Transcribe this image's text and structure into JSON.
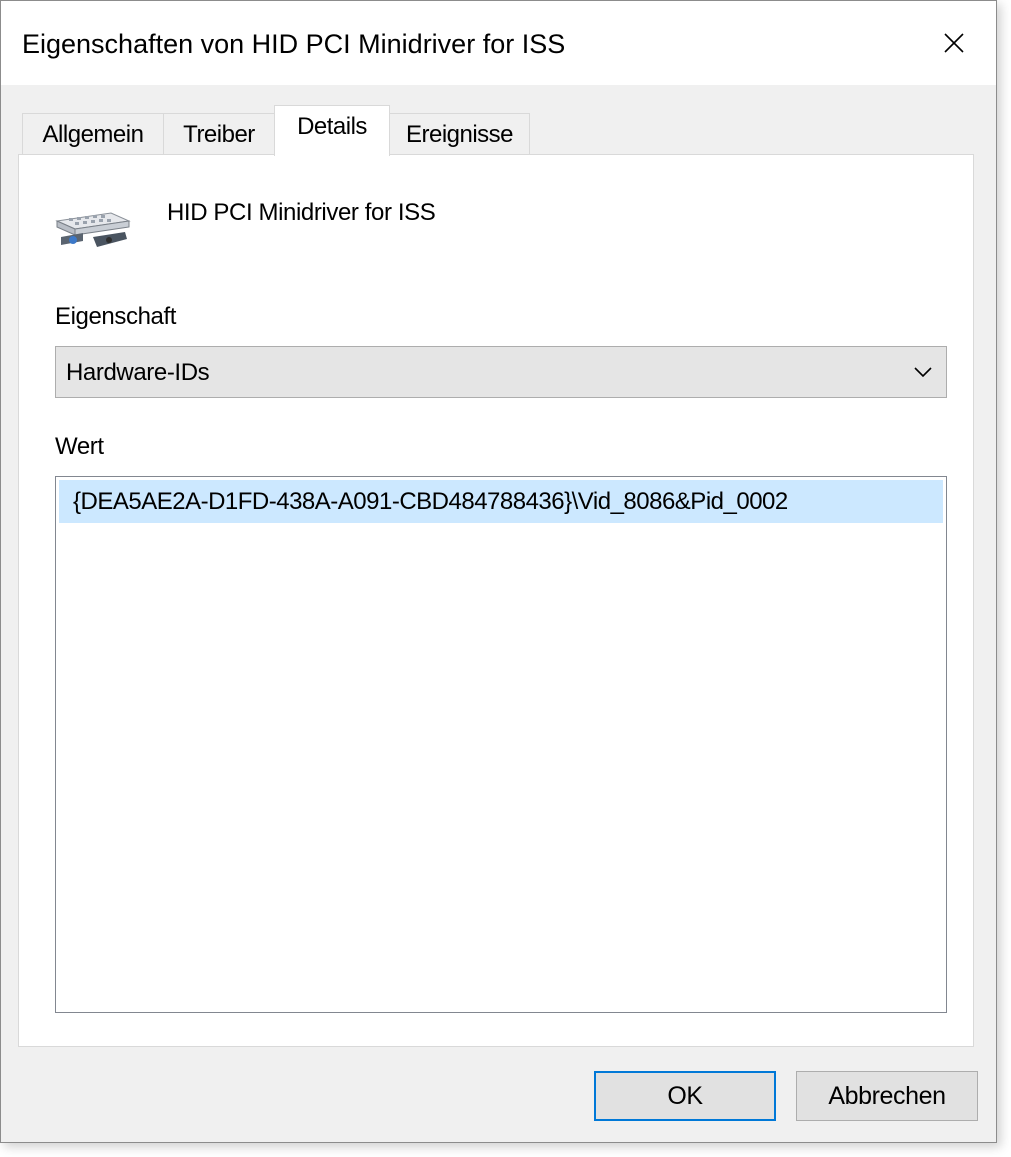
{
  "window": {
    "title": "Eigenschaften von HID PCI Minidriver for ISS",
    "close_icon": "close-icon"
  },
  "tabs": [
    {
      "label": "Allgemein",
      "active": false
    },
    {
      "label": "Treiber",
      "active": false
    },
    {
      "label": "Details",
      "active": true
    },
    {
      "label": "Ereignisse",
      "active": false
    }
  ],
  "details": {
    "device_name": "HID PCI Minidriver for ISS",
    "device_icon": "pci-device-icon",
    "property_label": "Eigenschaft",
    "property_selected": "Hardware-IDs",
    "value_label": "Wert",
    "values": [
      "{DEA5AE2A-D1FD-438A-A091-CBD484788436}\\Vid_8086&Pid_0002"
    ]
  },
  "buttons": {
    "ok": "OK",
    "cancel": "Abbrechen"
  },
  "colors": {
    "accent": "#0078d7",
    "selection": "#cce8ff",
    "dialog_bg": "#f0f0f0"
  }
}
